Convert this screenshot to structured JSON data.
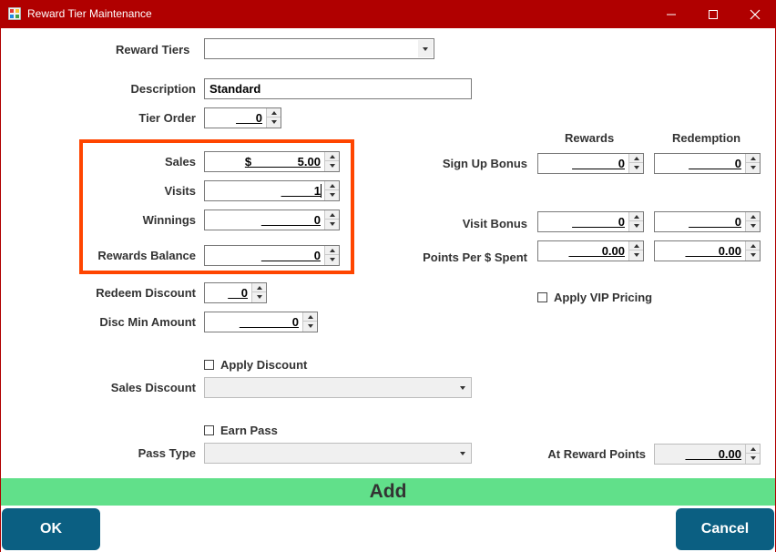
{
  "window": {
    "title": "Reward Tier Maintenance",
    "titlebar_color": "#b00000",
    "minimize_icon": "minimize-icon",
    "maximize_icon": "maximize-icon",
    "close_icon": "close-icon"
  },
  "left": {
    "reward_tiers": {
      "label": "Reward Tiers",
      "value": ""
    },
    "description": {
      "label": "Description",
      "value": "Standard"
    },
    "tier_order": {
      "label": "Tier Order",
      "value": "___0"
    },
    "sales": {
      "label": "Sales",
      "value": "$_______5.00"
    },
    "visits": {
      "label": "Visits",
      "value": "_____1"
    },
    "winnings": {
      "label": "Winnings",
      "value": "________0"
    },
    "rewards_balance": {
      "label": "Rewards Balance",
      "value": "________0"
    },
    "redeem_discount": {
      "label": "Redeem Discount",
      "value": "__0"
    },
    "disc_min_amount": {
      "label": "Disc Min Amount",
      "value": "________0"
    },
    "apply_discount": {
      "label": "Apply Discount",
      "checked": false
    },
    "sales_discount": {
      "label": "Sales Discount",
      "value": ""
    },
    "earn_pass": {
      "label": "Earn Pass",
      "checked": false
    },
    "pass_type": {
      "label": "Pass Type",
      "value": ""
    }
  },
  "right": {
    "col_rewards": "Rewards",
    "col_redemption": "Redemption",
    "sign_up_bonus": {
      "label": "Sign Up Bonus",
      "rewards": "_______0",
      "redemption": "_______0"
    },
    "visit_bonus": {
      "label": "Visit Bonus",
      "rewards": "_______0",
      "redemption": "_______0"
    },
    "points_per_dollar": {
      "label": "Points Per $ Spent",
      "rewards": "_____0.00",
      "redemption": "_____0.00"
    },
    "apply_vip": {
      "label": "Apply VIP Pricing",
      "checked": false
    },
    "at_reward_points": {
      "label": "At Reward Points",
      "value": "_____0.00"
    }
  },
  "actions": {
    "add": "Add",
    "ok": "OK",
    "cancel": "Cancel"
  },
  "colors": {
    "highlight": "#ff4500",
    "add_bar": "#61e08a",
    "button": "#0b5f82"
  }
}
